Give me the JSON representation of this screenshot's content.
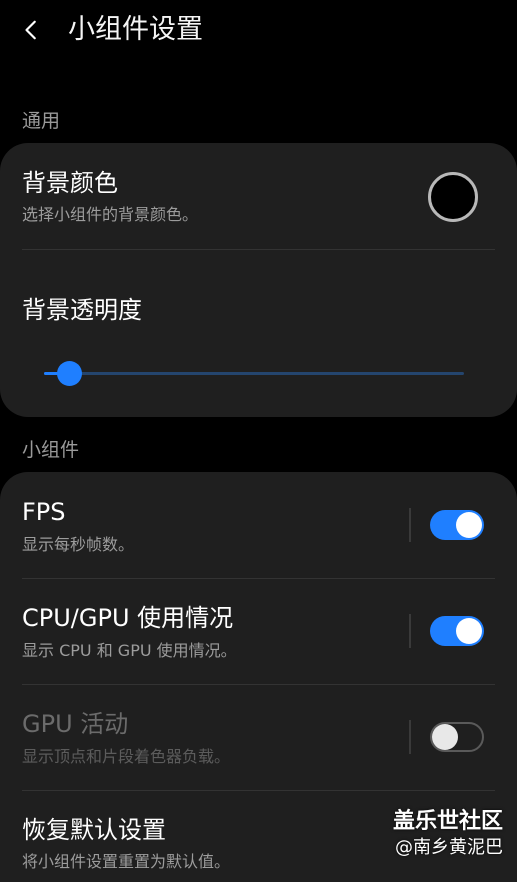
{
  "header": {
    "title": "小组件设置",
    "back_icon": "chevron-left-icon"
  },
  "sections": {
    "general_label": "通用",
    "widgets_label": "小组件"
  },
  "general": {
    "bg_color": {
      "title": "背景颜色",
      "subtitle": "选择小组件的背景颜色。",
      "swatch_color": "#000000"
    },
    "bg_opacity": {
      "title": "背景透明度",
      "slider_value_percent": 6
    }
  },
  "widgets": {
    "fps": {
      "title": "FPS",
      "subtitle": "显示每秒帧数。",
      "enabled": true
    },
    "cpu_gpu": {
      "title": "CPU/GPU 使用情况",
      "subtitle": "显示 CPU 和 GPU 使用情况。",
      "enabled": true
    },
    "gpu_activity": {
      "title": "GPU 活动",
      "subtitle": "显示顶点和片段着色器负载。",
      "enabled": false,
      "disabled_style": true
    },
    "reset": {
      "title": "恢复默认设置",
      "subtitle": "将小组件设置重置为默认值。"
    }
  },
  "watermark": {
    "brand": "盖乐世社区",
    "user": "@南乡黄泥巴"
  },
  "colors": {
    "accent": "#1f7fff",
    "card_bg": "#1f1f1f",
    "page_bg": "#000000"
  }
}
